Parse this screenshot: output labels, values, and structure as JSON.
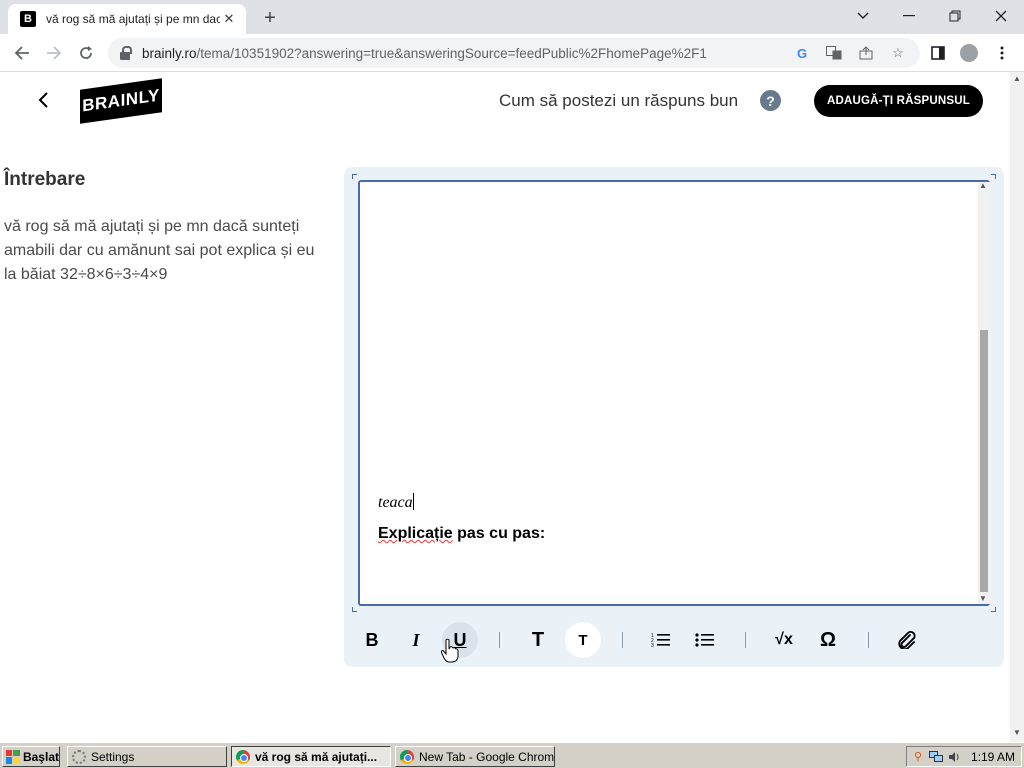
{
  "browser": {
    "tab_title": "vă rog să mă ajutați și pe mn dac",
    "tab_favicon": "B",
    "url_host": "brainly.ro",
    "url_rest": "/tema/10351902?answering=true&answeringSource=feedPublic%2FhomePage%2F1"
  },
  "header": {
    "logo_text": "BRAINLY",
    "howto_text": "Cum să postezi un răspuns bun",
    "help_glyph": "?",
    "add_answer_button": "ADAUGĂ-ȚI RĂSPUNSUL"
  },
  "question": {
    "heading": "Întrebare",
    "text": "vă rog să mă ajutați și pe mn dacă sunteți amabili dar cu amănunt sai pot explica și eu la băiat 32÷8×6÷3÷4×9"
  },
  "editor": {
    "answer_text": "teaca",
    "explanation_prefix": "Explicație",
    "explanation_suffix": " pas cu pas:"
  },
  "format_toolbar": {
    "bold": "B",
    "italic": "I",
    "underline": "U",
    "heading_large": "T",
    "heading_small": "T",
    "sqrt": "√x",
    "omega": "Ω"
  },
  "taskbar": {
    "start_label": "Başlat",
    "tasks": [
      {
        "label": "Settings"
      },
      {
        "label": "vă rog să mă ajutați..."
      },
      {
        "label": "New Tab - Google Chrome"
      }
    ],
    "clock": "1:19 AM"
  },
  "colors": {
    "editor_border": "#4a6ab0",
    "editor_panel": "#ebf2f7",
    "button_black": "#000000",
    "help_icon": "#687b8c"
  }
}
